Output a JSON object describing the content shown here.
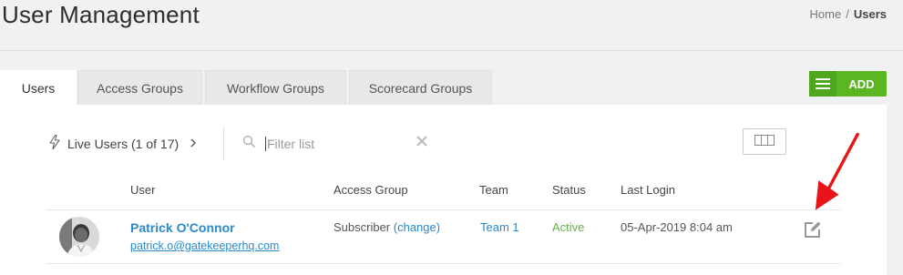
{
  "header": {
    "title": "User Management"
  },
  "breadcrumb": {
    "home": "Home",
    "separator": "/",
    "current": "Users"
  },
  "tabs": [
    {
      "label": "Users",
      "active": true
    },
    {
      "label": "Access Groups",
      "active": false
    },
    {
      "label": "Workflow Groups",
      "active": false
    },
    {
      "label": "Scorecard Groups",
      "active": false
    }
  ],
  "add_button": {
    "label": "ADD"
  },
  "toolbar": {
    "live_users_label": "Live Users (1 of 17)",
    "filter_placeholder": "Filter list"
  },
  "table": {
    "columns": [
      "User",
      "Access Group",
      "Team",
      "Status",
      "Last Login"
    ],
    "rows": [
      {
        "name": "Patrick O'Connor",
        "email": "patrick.o@gatekeeperhq.com",
        "access_group": "Subscriber",
        "change_link": "(change)",
        "team": "Team 1",
        "status": "Active",
        "last_login": "05-Apr-2019 8:04 am"
      }
    ]
  },
  "colors": {
    "accent_green": "#5cb623",
    "link_blue": "#2a8ac9",
    "status_active": "#6ab04c",
    "annotation_red": "#e8141a"
  },
  "icons": {
    "live_users": "lightning-icon",
    "search": "search-icon",
    "clear": "close-icon",
    "columns": "columns-icon",
    "menu": "hamburger-icon",
    "edit": "edit-icon"
  }
}
